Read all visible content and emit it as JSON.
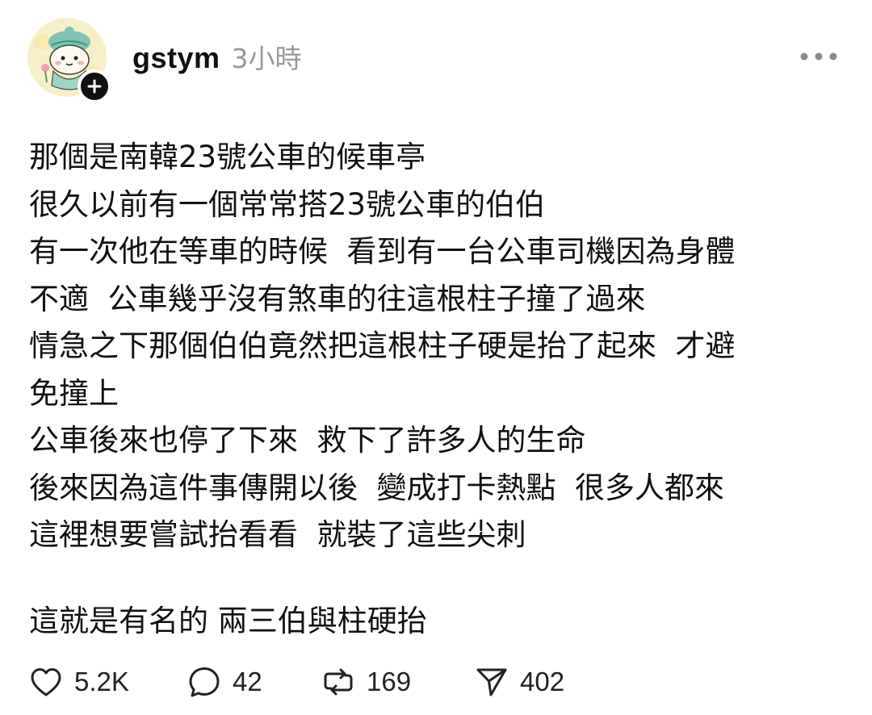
{
  "post": {
    "author": {
      "username": "gstym",
      "avatar": "avatar-character-icon",
      "follow_icon": "plus-icon"
    },
    "timestamp": "3小時",
    "more_icon": "ellipsis-icon",
    "body_lines": [
      "那個是南韓23號公車的候車亭",
      "很久以前有一個常常搭23號公車的伯伯",
      "有一次他在等車的時候  看到有一台公車司機因為身體",
      "不適  公車幾乎沒有煞車的往這根柱子撞了過來",
      "情急之下那個伯伯竟然把這根柱子硬是抬了起來  才避",
      "免撞上",
      "公車後來也停了下來  救下了許多人的生命",
      "後來因為這件事傳開以後  變成打卡熱點  很多人都來",
      "這裡想要嘗試抬看看  就裝了這些尖刺"
    ],
    "closing_line": "這就是有名的 兩三伯與柱硬抬",
    "actions": {
      "likes": {
        "icon": "heart-icon",
        "count": "5.2K"
      },
      "comments": {
        "icon": "comment-bubble-icon",
        "count": "42"
      },
      "reposts": {
        "icon": "repost-icon",
        "count": "169"
      },
      "shares": {
        "icon": "send-icon",
        "count": "402"
      }
    }
  },
  "colors": {
    "text": "#111111",
    "muted": "#999999",
    "background": "#ffffff",
    "avatar_bg": "#f5f0c8",
    "avatar_accent": "#7fc3b3"
  }
}
